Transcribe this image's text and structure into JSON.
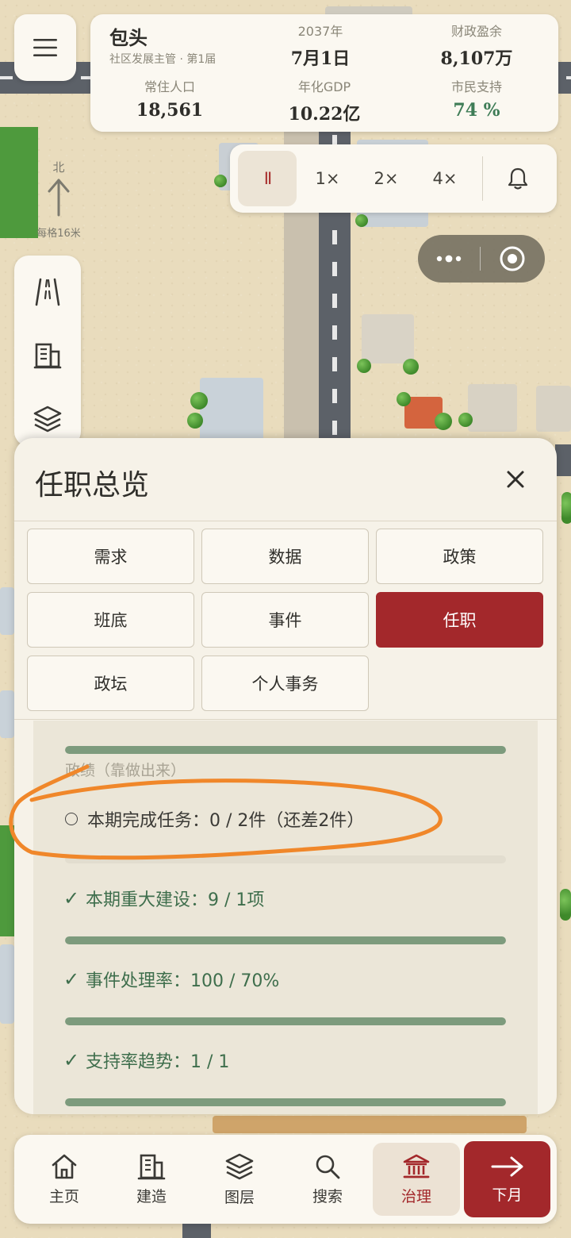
{
  "hud": {
    "city": "包头",
    "role": "社区发展主管 · 第1届",
    "year": "2037年",
    "date": "7月1日",
    "surplus_label": "财政盈余",
    "surplus_value": "8,107万",
    "population_label": "常住人口",
    "population_value": "18,561",
    "gdp_label": "年化GDP",
    "gdp_value": "10.22亿",
    "support_label": "市民支持",
    "support_value": "74 %"
  },
  "speed": {
    "pause": "II",
    "options": [
      "1×",
      "2×",
      "4×"
    ],
    "active": "pause"
  },
  "compass": {
    "north": "北",
    "scale": "每格16米"
  },
  "panel": {
    "title": "任职总览",
    "tabs": [
      "需求",
      "数据",
      "政策",
      "班底",
      "事件",
      "任职",
      "政坛",
      "个人事务"
    ],
    "active_tab": "任职",
    "section_label": "政绩（靠做出来）",
    "items": [
      {
        "status": "todo",
        "mark": "○",
        "text": "本期完成任务：0 / 2件（还差2件）",
        "progress": 0.0
      },
      {
        "status": "done",
        "mark": "✓",
        "text": "本期重大建设：9 / 1项",
        "progress": 1.0
      },
      {
        "status": "done",
        "mark": "✓",
        "text": "事件处理率：100 / 70%",
        "progress": 1.0
      },
      {
        "status": "done",
        "mark": "✓",
        "text": "支持率趋势：1 / 1",
        "progress": 1.0
      }
    ],
    "first_bar_progress": 1.0
  },
  "nav": {
    "items": [
      "主页",
      "建造",
      "图层",
      "搜索",
      "治理"
    ],
    "active": "治理",
    "next": "下月"
  },
  "colors": {
    "accent": "#a3282b",
    "success": "#3e7c56",
    "progress": "#7d9b7d",
    "annotation": "#f0872a"
  }
}
